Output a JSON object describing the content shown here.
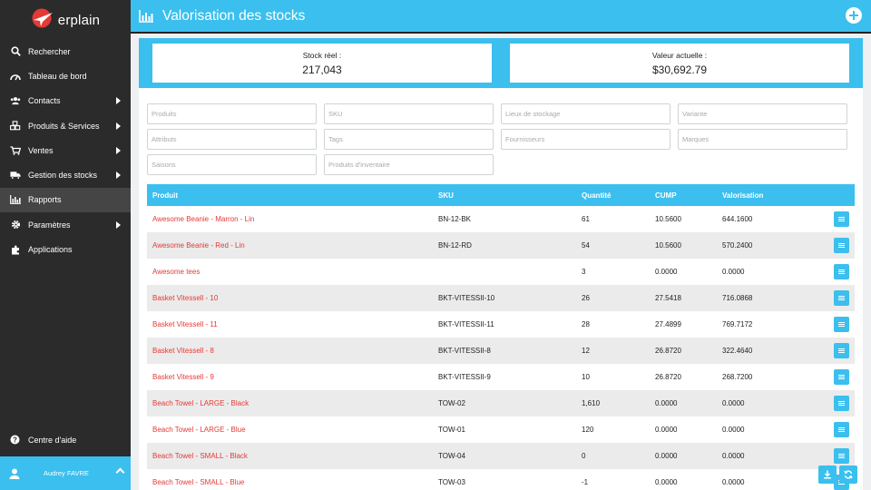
{
  "brand": {
    "name": "erplain",
    "accent": "#3bbfee",
    "logo_red": "#e53935"
  },
  "sidebar": {
    "items": [
      {
        "label": "Rechercher",
        "icon": "search-icon",
        "submenu": false
      },
      {
        "label": "Tableau de bord",
        "icon": "dashboard-icon",
        "submenu": false
      },
      {
        "label": "Contacts",
        "icon": "users-icon",
        "submenu": true
      },
      {
        "label": "Produits & Services",
        "icon": "cubes-icon",
        "submenu": true
      },
      {
        "label": "Ventes",
        "icon": "cart-icon",
        "submenu": true
      },
      {
        "label": "Gestion des stocks",
        "icon": "truck-icon",
        "submenu": true
      },
      {
        "label": "Rapports",
        "icon": "bar-chart-icon",
        "submenu": false,
        "active": true
      },
      {
        "label": "Paramètres",
        "icon": "gear-icon",
        "submenu": true
      },
      {
        "label": "Applications",
        "icon": "puzzle-icon",
        "submenu": false
      }
    ],
    "help_label": "Centre d'aide",
    "user_name": "Audrey FAVRE"
  },
  "header": {
    "title": "Valorisation des stocks"
  },
  "kpis": {
    "stock_label": "Stock réel :",
    "stock_value": "217,043",
    "value_label": "Valeur actuelle :",
    "value_value": "$30,692.79"
  },
  "filters": {
    "produits": "Produits",
    "sku": "SKU",
    "lieux": "Lieux de stockage",
    "variante": "Variante",
    "attributs": "Attributs",
    "tags": "Tags",
    "fournisseurs": "Fournisseurs",
    "marques": "Marques",
    "saisons": "Saisons",
    "inventaire": "Produits d'inventaire"
  },
  "table": {
    "headers": {
      "produit": "Produit",
      "sku": "SKU",
      "quantite": "Quantité",
      "cump": "CUMP",
      "valorisation": "Valorisation"
    },
    "rows": [
      {
        "produit": "Awesome Beanie - Marron - Lin",
        "sku": "BN-12-BK",
        "quantite": "61",
        "cump": "10.5600",
        "valorisation": "644.1600"
      },
      {
        "produit": "Awesome Beanie - Red - Lin",
        "sku": "BN-12-RD",
        "quantite": "54",
        "cump": "10.5600",
        "valorisation": "570.2400"
      },
      {
        "produit": "Awesome tees",
        "sku": "",
        "quantite": "3",
        "cump": "0.0000",
        "valorisation": "0.0000"
      },
      {
        "produit": "Basket Vitessell - 10",
        "sku": "BKT-VITESSII-10",
        "quantite": "26",
        "cump": "27.5418",
        "valorisation": "716.0868"
      },
      {
        "produit": "Basket Vitessell - 11",
        "sku": "BKT-VITESSII-11",
        "quantite": "28",
        "cump": "27.4899",
        "valorisation": "769.7172"
      },
      {
        "produit": "Basket Vitessell - 8",
        "sku": "BKT-VITESSII-8",
        "quantite": "12",
        "cump": "26.8720",
        "valorisation": "322.4640"
      },
      {
        "produit": "Basket Vitessell - 9",
        "sku": "BKT-VITESSII-9",
        "quantite": "10",
        "cump": "26.8720",
        "valorisation": "268.7200"
      },
      {
        "produit": "Beach Towel - LARGE - Black",
        "sku": "TOW-02",
        "quantite": "1,610",
        "cump": "0.0000",
        "valorisation": "0.0000"
      },
      {
        "produit": "Beach Towel - LARGE - Blue",
        "sku": "TOW-01",
        "quantite": "120",
        "cump": "0.0000",
        "valorisation": "0.0000"
      },
      {
        "produit": "Beach Towel - SMALL - Black",
        "sku": "TOW-04",
        "quantite": "0",
        "cump": "0.0000",
        "valorisation": "0.0000"
      },
      {
        "produit": "Beach Towel - SMALL - Blue",
        "sku": "TOW-03",
        "quantite": "-1",
        "cump": "0.0000",
        "valorisation": "0.0000"
      }
    ]
  }
}
